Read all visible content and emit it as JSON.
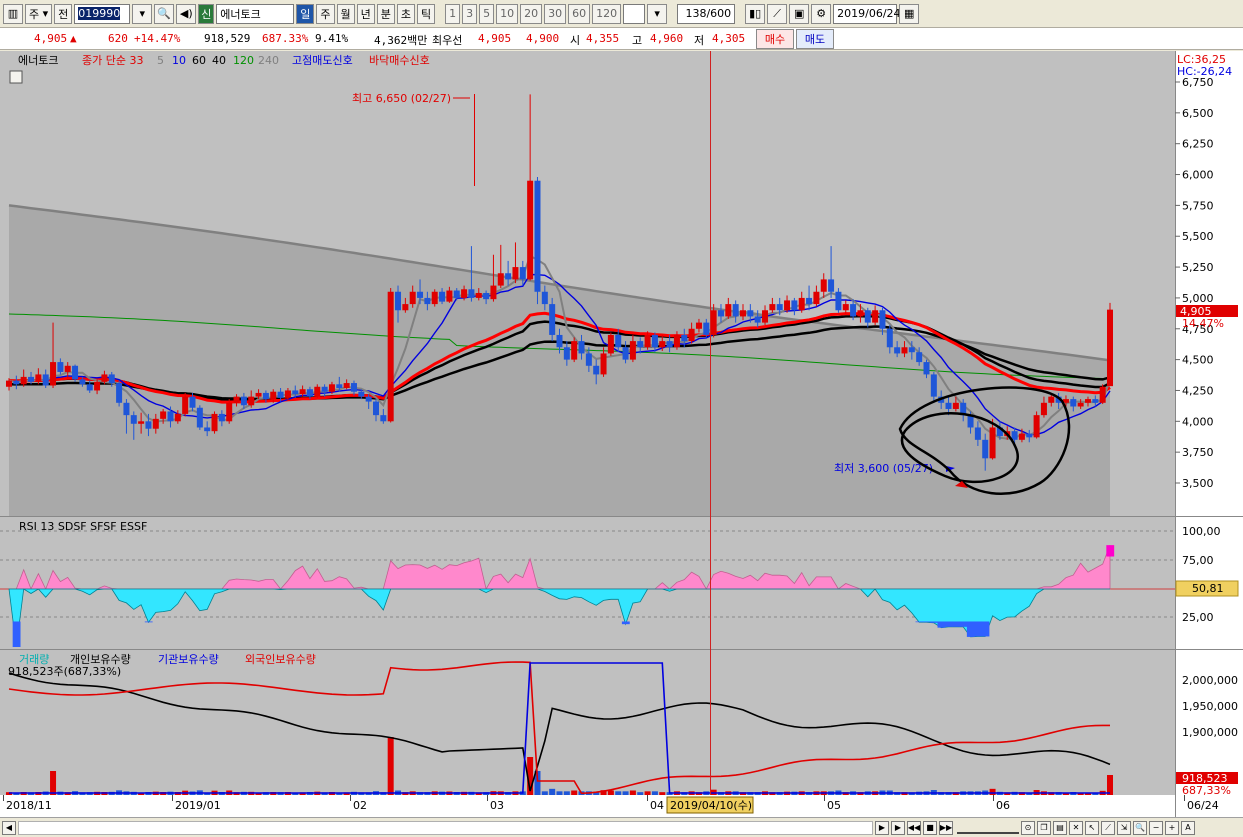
{
  "toolbar": {
    "market": "주",
    "prev_label": "전",
    "code": "019990",
    "badge": "신",
    "name": "에너토크",
    "periods": [
      "일",
      "주",
      "월",
      "년",
      "분",
      "초",
      "틱"
    ],
    "active_period": "일",
    "intervals": [
      "1",
      "3",
      "5",
      "10",
      "20",
      "30",
      "60",
      "120"
    ],
    "count": "138",
    "count_total": "/600",
    "date": "2019/06/24"
  },
  "quote": {
    "price": "4,905",
    "arrow": "▲",
    "change": "620",
    "change_pct": "+14.47%",
    "volume": "918,529",
    "volume_ratio": "687.33%",
    "turnover": "9.41%",
    "amount": "4,362백만",
    "best_label": "최우선",
    "best_ask": "4,905",
    "best_bid": "4,900",
    "open_label": "시",
    "open": "4,355",
    "high_label": "고",
    "high": "4,960",
    "low_label": "저",
    "low": "4,305",
    "buy_label": "매수",
    "sell_label": "매도"
  },
  "legend": {
    "name": "에너토크",
    "close_ma": "종가 단순 33",
    "ma_periods": [
      "5",
      "10",
      "60",
      "40",
      "120",
      "240"
    ],
    "signal_sell": "고점매도신호",
    "signal_buy": "바닥매수신호",
    "lc": "LC:36,25",
    "hc": "HC:-26,24"
  },
  "rsi_legend": "RSI 13  SDSF  SFSF  ESSF",
  "volume_legend": {
    "volume": "거래량",
    "individual": "개인보유수량",
    "institution": "기관보유수량",
    "foreign": "외국인보유수량",
    "current": "918,523주(687,33%)"
  },
  "chart_data": {
    "type": "candlestick",
    "price_axis": {
      "ticks": [
        "6,750",
        "6,500",
        "6,250",
        "6,000",
        "5,750",
        "5,500",
        "5,250",
        "5,000",
        "4,750",
        "4,500",
        "4,250",
        "4,000",
        "3,750",
        "3,500"
      ],
      "ylim": [
        3300,
        6800
      ]
    },
    "annotations": {
      "high": "최고 6,650 (02/27)",
      "low": "최저 3,600 (05/27)"
    },
    "last_price": "4,905",
    "last_pct": "14.47%",
    "rsi_axis": {
      "ticks": [
        "100,00",
        "75,00",
        "25,00"
      ],
      "current": "50,81"
    },
    "volume_axis": {
      "ticks": [
        "2,000,000",
        "1,950,000",
        "1,900,000"
      ],
      "current": "918,523",
      "current_pct": "687,33%"
    },
    "x_labels": [
      "2018/11",
      "2019/01",
      "02",
      "03",
      "04",
      "05",
      "06",
      "06/24"
    ],
    "cursor_date": "2019/04/10(수)",
    "candles": [
      [
        4280,
        4330,
        4250,
        4350
      ],
      [
        4330,
        4300,
        4260,
        4370
      ],
      [
        4300,
        4360,
        4280,
        4420
      ],
      [
        4360,
        4320,
        4300,
        4400
      ],
      [
        4320,
        4380,
        4300,
        4430
      ],
      [
        4380,
        4290,
        4270,
        4420
      ],
      [
        4290,
        4480,
        4270,
        4800
      ],
      [
        4480,
        4400,
        4380,
        4510
      ],
      [
        4400,
        4450,
        4350,
        4480
      ],
      [
        4450,
        4340,
        4320,
        4460
      ],
      [
        4340,
        4300,
        4280,
        4360
      ],
      [
        4300,
        4250,
        4230,
        4330
      ],
      [
        4250,
        4320,
        4220,
        4340
      ],
      [
        4320,
        4380,
        4300,
        4410
      ],
      [
        4380,
        4310,
        4280,
        4400
      ],
      [
        4310,
        4150,
        4120,
        4330
      ],
      [
        4150,
        4050,
        3900,
        4180
      ],
      [
        4050,
        3980,
        3850,
        4080
      ],
      [
        3980,
        4000,
        3900,
        4070
      ],
      [
        4000,
        3940,
        3880,
        4060
      ],
      [
        3940,
        4020,
        3900,
        4060
      ],
      [
        4020,
        4080,
        3980,
        4100
      ],
      [
        4080,
        4000,
        3950,
        4120
      ],
      [
        4000,
        4060,
        3980,
        4090
      ],
      [
        4060,
        4200,
        4040,
        4230
      ],
      [
        4200,
        4110,
        4080,
        4230
      ],
      [
        4110,
        3950,
        3930,
        4130
      ],
      [
        3950,
        3920,
        3880,
        4000
      ],
      [
        3920,
        4060,
        3900,
        4080
      ],
      [
        4060,
        4000,
        3960,
        4090
      ],
      [
        4000,
        4150,
        3980,
        4180
      ],
      [
        4150,
        4200,
        4120,
        4220
      ],
      [
        4200,
        4130,
        4100,
        4230
      ],
      [
        4130,
        4200,
        4110,
        4250
      ],
      [
        4200,
        4230,
        4180,
        4260
      ],
      [
        4230,
        4180,
        4150,
        4250
      ],
      [
        4180,
        4240,
        4150,
        4260
      ],
      [
        4240,
        4190,
        4160,
        4270
      ],
      [
        4190,
        4250,
        4170,
        4270
      ],
      [
        4250,
        4220,
        4190,
        4290
      ],
      [
        4220,
        4260,
        4200,
        4290
      ],
      [
        4260,
        4200,
        4180,
        4280
      ],
      [
        4200,
        4280,
        4190,
        4300
      ],
      [
        4280,
        4240,
        4200,
        4300
      ],
      [
        4240,
        4300,
        4220,
        4320
      ],
      [
        4300,
        4270,
        4240,
        4360
      ],
      [
        4270,
        4310,
        4260,
        4340
      ],
      [
        4310,
        4240,
        4210,
        4330
      ],
      [
        4240,
        4200,
        4180,
        4260
      ],
      [
        4200,
        4160,
        4100,
        4220
      ],
      [
        4160,
        4050,
        4000,
        4180
      ],
      [
        4050,
        4000,
        3980,
        4100
      ],
      [
        4000,
        5050,
        3990,
        5080
      ],
      [
        5050,
        4900,
        4800,
        5100
      ],
      [
        4900,
        4950,
        4880,
        5000
      ],
      [
        4950,
        5050,
        4920,
        5100
      ],
      [
        5050,
        5000,
        4950,
        5150
      ],
      [
        5000,
        4950,
        4900,
        5050
      ],
      [
        4950,
        5050,
        4930,
        5070
      ],
      [
        5050,
        4970,
        4950,
        5080
      ],
      [
        4970,
        5060,
        4960,
        5090
      ],
      [
        5060,
        5000,
        4980,
        5080
      ],
      [
        5000,
        5070,
        4980,
        5100
      ],
      [
        5070,
        5000,
        4970,
        5420
      ],
      [
        5000,
        5040,
        4980,
        5080
      ],
      [
        5040,
        4990,
        4950,
        5060
      ],
      [
        4990,
        5100,
        4970,
        5350
      ],
      [
        5100,
        5200,
        5080,
        5430
      ],
      [
        5200,
        5150,
        5100,
        5300
      ],
      [
        5150,
        5250,
        5120,
        5450
      ],
      [
        5250,
        5150,
        5100,
        5300
      ],
      [
        5150,
        5950,
        5140,
        6650
      ],
      [
        5950,
        5050,
        4950,
        5980
      ],
      [
        5050,
        4950,
        4900,
        5100
      ],
      [
        4950,
        4700,
        4650,
        5000
      ],
      [
        4700,
        4600,
        4550,
        4750
      ],
      [
        4600,
        4500,
        4450,
        4650
      ],
      [
        4500,
        4650,
        4480,
        4680
      ],
      [
        4650,
        4550,
        4500,
        4700
      ],
      [
        4550,
        4450,
        4400,
        4600
      ],
      [
        4450,
        4380,
        4300,
        4500
      ],
      [
        4380,
        4550,
        4360,
        4600
      ],
      [
        4550,
        4700,
        4530,
        4720
      ],
      [
        4700,
        4600,
        4560,
        4750
      ],
      [
        4600,
        4500,
        4470,
        4650
      ],
      [
        4500,
        4650,
        4480,
        4700
      ],
      [
        4650,
        4600,
        4550,
        4680
      ],
      [
        4600,
        4700,
        4580,
        4730
      ],
      [
        4700,
        4600,
        4560,
        4720
      ],
      [
        4600,
        4650,
        4570,
        4700
      ],
      [
        4650,
        4600,
        4560,
        4700
      ],
      [
        4600,
        4700,
        4580,
        4730
      ],
      [
        4700,
        4650,
        4600,
        4750
      ],
      [
        4650,
        4750,
        4630,
        4800
      ],
      [
        4750,
        4800,
        4720,
        4830
      ],
      [
        4800,
        4700,
        4680,
        4830
      ],
      [
        4700,
        4900,
        4680,
        4950
      ],
      [
        4900,
        4850,
        4800,
        4950
      ],
      [
        4850,
        4950,
        4830,
        5000
      ],
      [
        4950,
        4850,
        4800,
        4980
      ],
      [
        4850,
        4900,
        4820,
        4950
      ],
      [
        4900,
        4850,
        4800,
        4950
      ],
      [
        4850,
        4800,
        4760,
        4900
      ],
      [
        4800,
        4900,
        4780,
        4940
      ],
      [
        4900,
        4950,
        4880,
        5000
      ],
      [
        4950,
        4900,
        4860,
        5000
      ],
      [
        4900,
        4980,
        4880,
        5020
      ],
      [
        4980,
        4900,
        4860,
        5000
      ],
      [
        4900,
        5000,
        4880,
        5050
      ],
      [
        5000,
        4950,
        4900,
        5100
      ],
      [
        4950,
        5050,
        4930,
        5100
      ],
      [
        5050,
        5150,
        5000,
        5200
      ],
      [
        5150,
        5050,
        5000,
        5420
      ],
      [
        5050,
        4900,
        4880,
        5080
      ],
      [
        4900,
        4950,
        4870,
        4980
      ],
      [
        4950,
        4850,
        4820,
        4990
      ],
      [
        4850,
        4900,
        4800,
        4950
      ],
      [
        4900,
        4800,
        4760,
        4920
      ],
      [
        4800,
        4900,
        4780,
        4940
      ],
      [
        4900,
        4750,
        4700,
        4920
      ],
      [
        4750,
        4600,
        4550,
        4780
      ],
      [
        4600,
        4550,
        4520,
        4650
      ],
      [
        4550,
        4600,
        4520,
        4650
      ],
      [
        4600,
        4560,
        4500,
        4650
      ],
      [
        4560,
        4480,
        4450,
        4600
      ],
      [
        4480,
        4380,
        4350,
        4500
      ],
      [
        4380,
        4200,
        4150,
        4400
      ],
      [
        4200,
        4150,
        4100,
        4250
      ],
      [
        4150,
        4100,
        4050,
        4200
      ],
      [
        4100,
        4150,
        4080,
        4200
      ],
      [
        4150,
        4050,
        4000,
        4180
      ],
      [
        4050,
        3950,
        3900,
        4080
      ],
      [
        3950,
        3850,
        3800,
        4000
      ],
      [
        3850,
        3700,
        3600,
        3900
      ],
      [
        3700,
        3950,
        3690,
        4020
      ],
      [
        3950,
        3880,
        3850,
        4000
      ],
      [
        3880,
        3920,
        3850,
        3960
      ],
      [
        3920,
        3850,
        3820,
        3950
      ],
      [
        3850,
        3900,
        3830,
        3940
      ],
      [
        3900,
        3870,
        3830,
        3930
      ],
      [
        3870,
        4050,
        3860,
        4080
      ],
      [
        4050,
        4150,
        4030,
        4200
      ],
      [
        4150,
        4200,
        4120,
        4230
      ],
      [
        4200,
        4150,
        4100,
        4230
      ],
      [
        4150,
        4180,
        4120,
        4210
      ],
      [
        4180,
        4120,
        4080,
        4200
      ],
      [
        4120,
        4150,
        4100,
        4180
      ],
      [
        4150,
        4180,
        4120,
        4200
      ],
      [
        4180,
        4150,
        4120,
        4210
      ],
      [
        4150,
        4280,
        4140,
        4300
      ],
      [
        4285,
        4905,
        4305,
        4960
      ]
    ]
  },
  "bottom": {
    "left_arrow": "◀",
    "right_arrow": "▶",
    "font_label": "A"
  },
  "colors": {
    "up": "#e00000",
    "down": "#1f56d8",
    "ma5": "#808080",
    "ma10": "#0000e0",
    "ma33": "#ff0000",
    "ma60": "#000000",
    "ma120": "#009000",
    "ma240": "#808080",
    "rsi_up": "#ff88cc",
    "rsi_down": "#33e6ff"
  }
}
